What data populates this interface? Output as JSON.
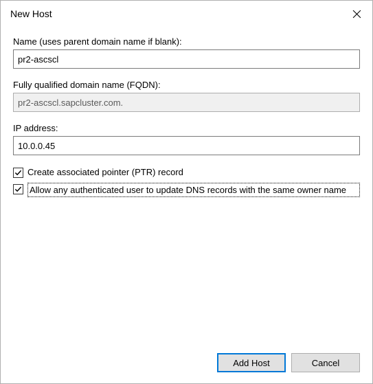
{
  "window": {
    "title": "New Host"
  },
  "fields": {
    "name": {
      "label": "Name (uses parent domain name if blank):",
      "value": "pr2-ascscl"
    },
    "fqdn": {
      "label": "Fully qualified domain name (FQDN):",
      "value": "pr2-ascscl.sapcluster.com."
    },
    "ip": {
      "label": "IP address:",
      "value": "10.0.0.45"
    }
  },
  "checkboxes": {
    "ptr": {
      "label": "Create associated pointer (PTR) record",
      "checked": true
    },
    "allow_update": {
      "label": "Allow any authenticated user to update DNS records with the same owner name",
      "checked": true
    }
  },
  "buttons": {
    "add_host": "Add Host",
    "cancel": "Cancel"
  }
}
